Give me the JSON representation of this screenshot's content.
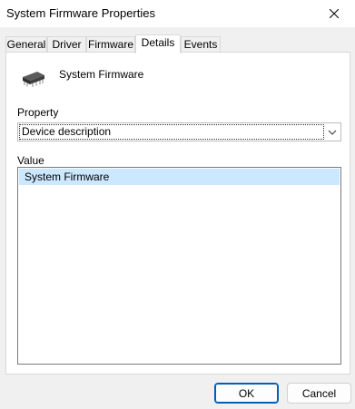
{
  "window": {
    "title": "System Firmware Properties"
  },
  "tabs": [
    {
      "label": "General"
    },
    {
      "label": "Driver"
    },
    {
      "label": "Firmware"
    },
    {
      "label": "Details"
    },
    {
      "label": "Events"
    }
  ],
  "active_tab": "Details",
  "device": {
    "name": "System Firmware",
    "icon": "chip-icon"
  },
  "property": {
    "label": "Property",
    "selected": "Device description"
  },
  "value": {
    "label": "Value",
    "items": [
      "System Firmware"
    ]
  },
  "buttons": {
    "ok": "OK",
    "cancel": "Cancel"
  },
  "colors": {
    "selection": "#cce8ff",
    "accent": "#005fb8"
  }
}
